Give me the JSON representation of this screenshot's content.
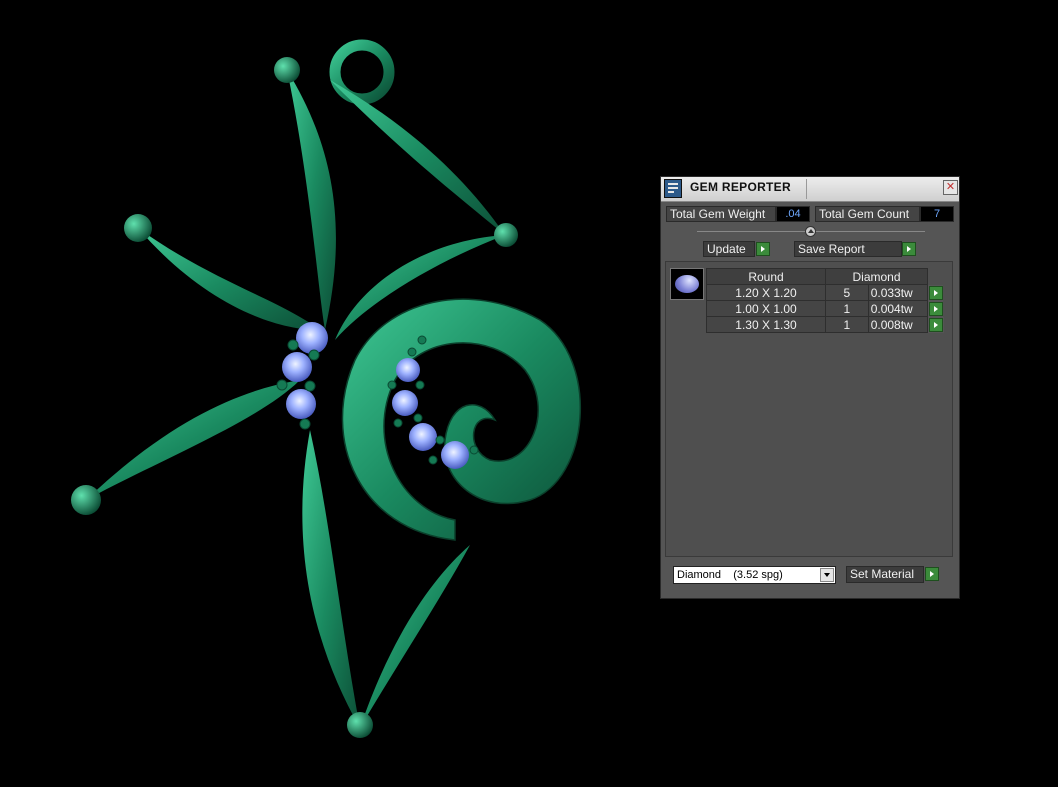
{
  "window": {
    "title": "GEM REPORTER",
    "close_glyph": "✕"
  },
  "stats": {
    "total_weight_label": "Total Gem Weight",
    "total_weight_value": ".04",
    "total_count_label": "Total Gem Count",
    "total_count_value": "7"
  },
  "actions": {
    "update_label": "Update",
    "save_report_label": "Save Report"
  },
  "table": {
    "headers": [
      "Round",
      "Diamond"
    ],
    "rows": [
      {
        "size": "1.20 X 1.20",
        "count": "5",
        "weight": "0.033tw"
      },
      {
        "size": "1.00 X 1.00",
        "count": "1",
        "weight": "0.004tw"
      },
      {
        "size": "1.30 X 1.30",
        "count": "1",
        "weight": "0.008tw"
      }
    ]
  },
  "material": {
    "selected": "Diamond    (3.52 spg)",
    "set_label": "Set Material"
  },
  "colors": {
    "metal": "#1f8a63",
    "gem": "#8fa2ff",
    "panel": "#555555",
    "go_button": "#3b8b3b"
  },
  "viewport": {
    "model": "pendant",
    "icons": [
      "gem-reporter-icon",
      "close-icon",
      "slider-knob-icon",
      "round-gem-icon",
      "dropdown-arrow-icon"
    ]
  }
}
